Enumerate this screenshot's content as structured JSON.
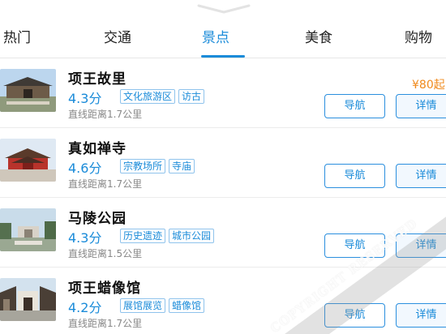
{
  "tabs": [
    {
      "label": "热门",
      "active": false
    },
    {
      "label": "交通",
      "active": false
    },
    {
      "label": "景点",
      "active": true
    },
    {
      "label": "美食",
      "active": false
    },
    {
      "label": "购物",
      "active": false
    }
  ],
  "colors": {
    "accent": "#1a8bd9",
    "price": "#f08a1c"
  },
  "icons": {
    "pull_handle": "chevron-down-icon"
  },
  "items": [
    {
      "name": "项王故里",
      "score": "4.3分",
      "tags": [
        "文化旅游区",
        "访古"
      ],
      "distance": "直线距离1.7公里",
      "price": "¥80起",
      "nav_label": "导航",
      "detail_label": "详情"
    },
    {
      "name": "真如禅寺",
      "score": "4.6分",
      "tags": [
        "宗教场所",
        "寺庙"
      ],
      "distance": "直线距离1.7公里",
      "nav_label": "导航",
      "detail_label": "详情"
    },
    {
      "name": "马陵公园",
      "score": "4.3分",
      "tags": [
        "历史遗迹",
        "城市公园"
      ],
      "distance": "直线距离1.5公里",
      "nav_label": "导航",
      "detail_label": "详情"
    },
    {
      "name": "项王蜡像馆",
      "score": "4.2分",
      "tags": [
        "展馆展览",
        "蜡像馆"
      ],
      "distance": "直线距离1.7公里",
      "nav_label": "导航",
      "detail_label": "详情"
    }
  ],
  "watermark": "COPYRIGHT RESERVED"
}
